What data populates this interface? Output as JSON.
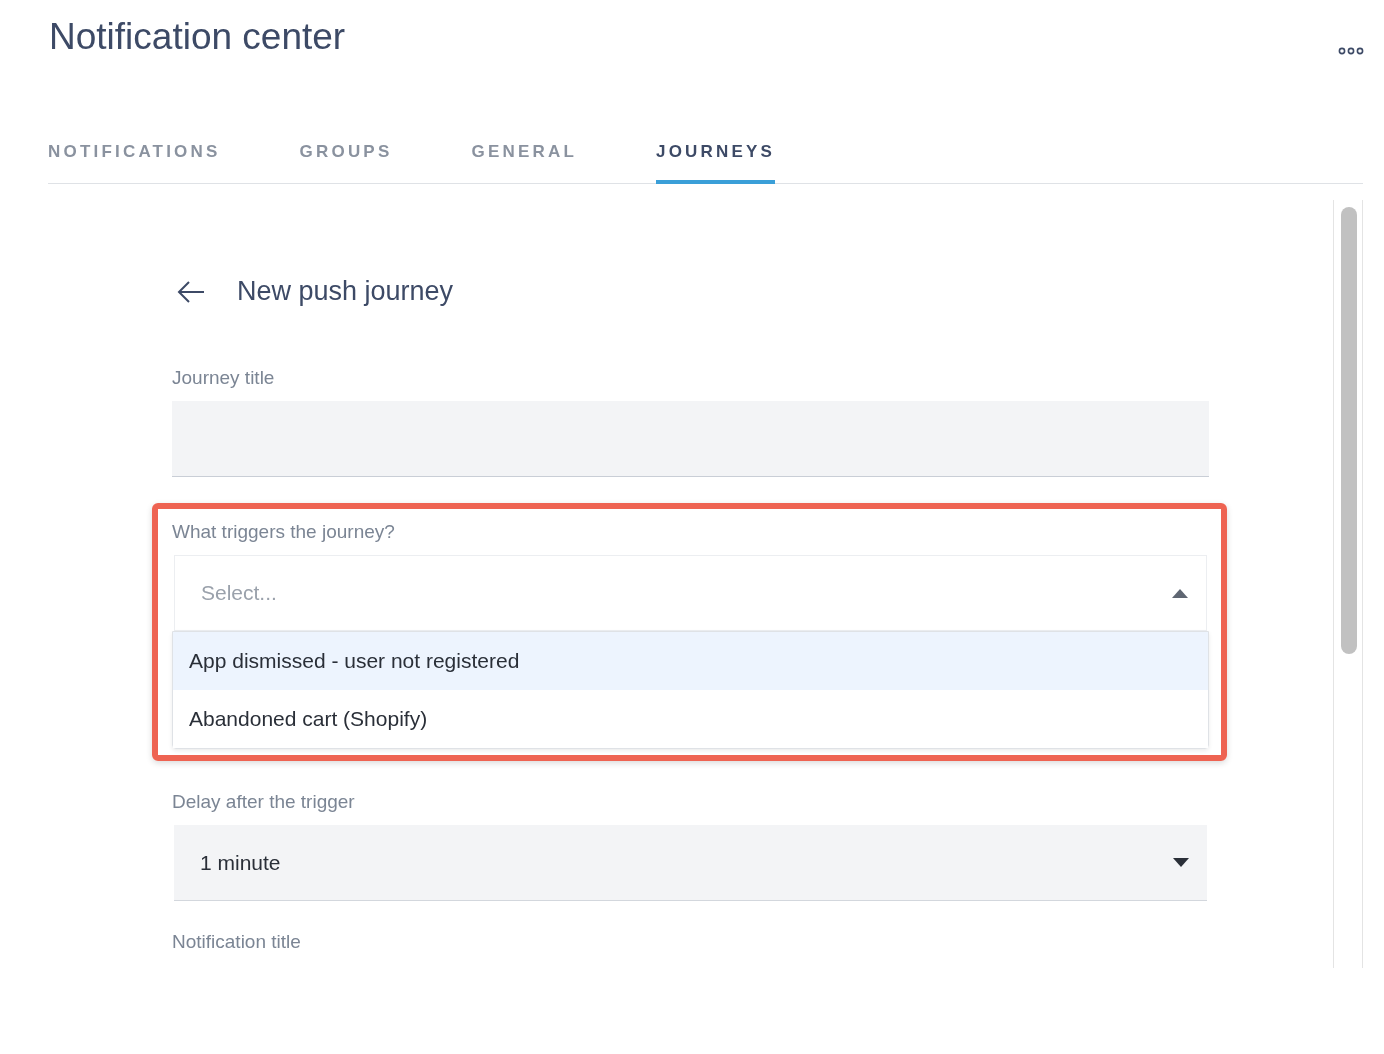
{
  "header": {
    "title": "Notification center"
  },
  "tabs": [
    {
      "label": "NOTIFICATIONS",
      "selected": false
    },
    {
      "label": "GROUPS",
      "selected": false
    },
    {
      "label": "GENERAL",
      "selected": false
    },
    {
      "label": "JOURNEYS",
      "selected": true
    }
  ],
  "journey": {
    "heading": "New push journey",
    "fields": [
      {
        "kind": "text",
        "label": "Journey title",
        "highlighted": false
      },
      {
        "kind": "select-open",
        "label": "What triggers the journey?",
        "placeholder": "Select...",
        "highlighted": true,
        "options": [
          {
            "label": "App dismissed - user not registered",
            "selected": true
          },
          {
            "label": "Abandoned cart (Shopify)",
            "selected": false
          }
        ]
      },
      {
        "kind": "select",
        "label": "Delay after the trigger",
        "value": "1 minute",
        "highlighted": false
      },
      {
        "kind": "label",
        "label": "Notification title",
        "highlighted": false
      }
    ]
  }
}
